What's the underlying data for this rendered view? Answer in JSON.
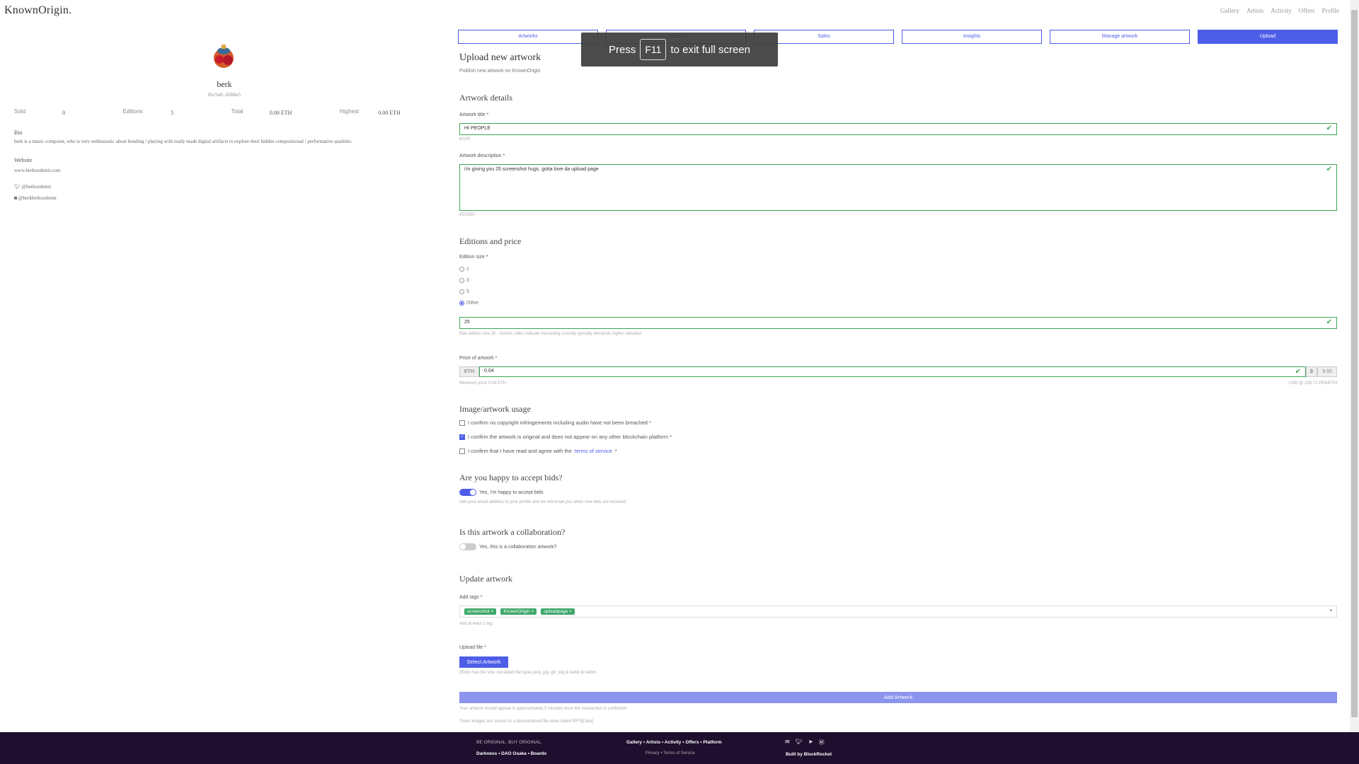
{
  "brand": "KnownOrigin.",
  "topnav": [
    "Gallery",
    "Artists",
    "Activity",
    "Offers",
    "Profile"
  ],
  "profile": {
    "name": "berk",
    "address": "0xc5e0...b5b6e5",
    "stats": [
      {
        "label": "Sold",
        "value": "0"
      },
      {
        "label": "Editions",
        "value": "5"
      },
      {
        "label": "Total",
        "value": "0.00 ETH"
      },
      {
        "label": "Highest",
        "value": "0.00 ETH"
      }
    ],
    "bio_heading": "Bio",
    "bio": "berk is a music composer, who is very enthusiastic about bending / playing with ready made digital artifacts to explore their hidden compositional / performative qualities.",
    "website_heading": "Website",
    "website": "www.berkozdemir.com",
    "twitter": "@berkozdemir",
    "instagram": "@berkberkozdemir"
  },
  "tabs": [
    {
      "label": "Artworks",
      "active": false
    },
    {
      "label": "Offers",
      "active": false
    },
    {
      "label": "Sales",
      "active": false
    },
    {
      "label": "Insights",
      "active": false
    },
    {
      "label": "Manage artwork",
      "active": false
    },
    {
      "label": "Upload",
      "active": true
    }
  ],
  "f11": {
    "pre": "Press",
    "key": "F11",
    "post": "to exit full screen"
  },
  "form": {
    "title": "Upload new artwork",
    "subtitle": "Publish new artwork on KnownOrigin",
    "details_heading": "Artwork details",
    "title_label": "Artwork title *",
    "title_value": "HI PEOPLE",
    "title_count": "9/100",
    "desc_label": "Artwork description *",
    "desc_value": "i'm giving you 25 screenshot hugs. gotta love da upload page",
    "desc_count": "60/1000",
    "editions_heading": "Editions and price",
    "edition_label": "Edition size *",
    "edition_options": [
      "1",
      "3",
      "5",
      "Other"
    ],
    "edition_selected": "Other",
    "edition_value": "25",
    "edition_hint": "Max edition size 25 - historic sales indicate increasing scarcity typically demands higher valuation",
    "price_label": "Price of artwork *",
    "price_currency": "ETH",
    "price_value": "0.04",
    "price_usd_symbol": "$",
    "price_usd": "9.55",
    "price_hint": "Minimum price 0.04 ETH",
    "price_rate": "USD @ 238.71 PER/ETH",
    "usage_heading": "Image/artwork usage",
    "confirm1": "I confirm no copyright infringements including audio have not been breached *",
    "confirm2": "I confirm the artwork is original and does not appear on any other blockchain platform *",
    "confirm3_pre": "I confirm that I have read and agree with the",
    "confirm3_link": "terms of service",
    "confirm3_post": "*",
    "bids_heading": "Are you happy to accept bids?",
    "bids_toggle": "Yes, I'm happy to accept bids",
    "bids_hint": "Add your email address to your profile and we will email you when new bids are received",
    "collab_heading": "Is this artwork a collaboration?",
    "collab_toggle": "Yes, this is a collaboration artwork?",
    "update_heading": "Update artwork",
    "tags_label": "Add tags *",
    "tags": [
      "screenshot",
      "KnownOrigin",
      "uploadpage"
    ],
    "tags_hint": "Add at least 1 tag",
    "upload_label": "Upload file *",
    "select_button": "Select Artwork",
    "upload_hint": "25mb max file size. Accepted file types png, jpg, gif, svg & webp & webm",
    "add_button": "Add Artwork",
    "footnote1": "Your artwork should appear in approximately 5 minutes once the transaction is confirmed",
    "footnote2": "Token images are stored on a decentralised file store called IPFS[Data]"
  },
  "footer": {
    "tagline": "BE ORIGINAL. BUY ORIGINAL.",
    "links1": "Darkness • DAO Osaka • Boards",
    "nav": "Gallery • Artists • Activity • Offers • Platform",
    "legal": "Privacy • Terms of Service",
    "built": "Built by BlockRocket"
  }
}
